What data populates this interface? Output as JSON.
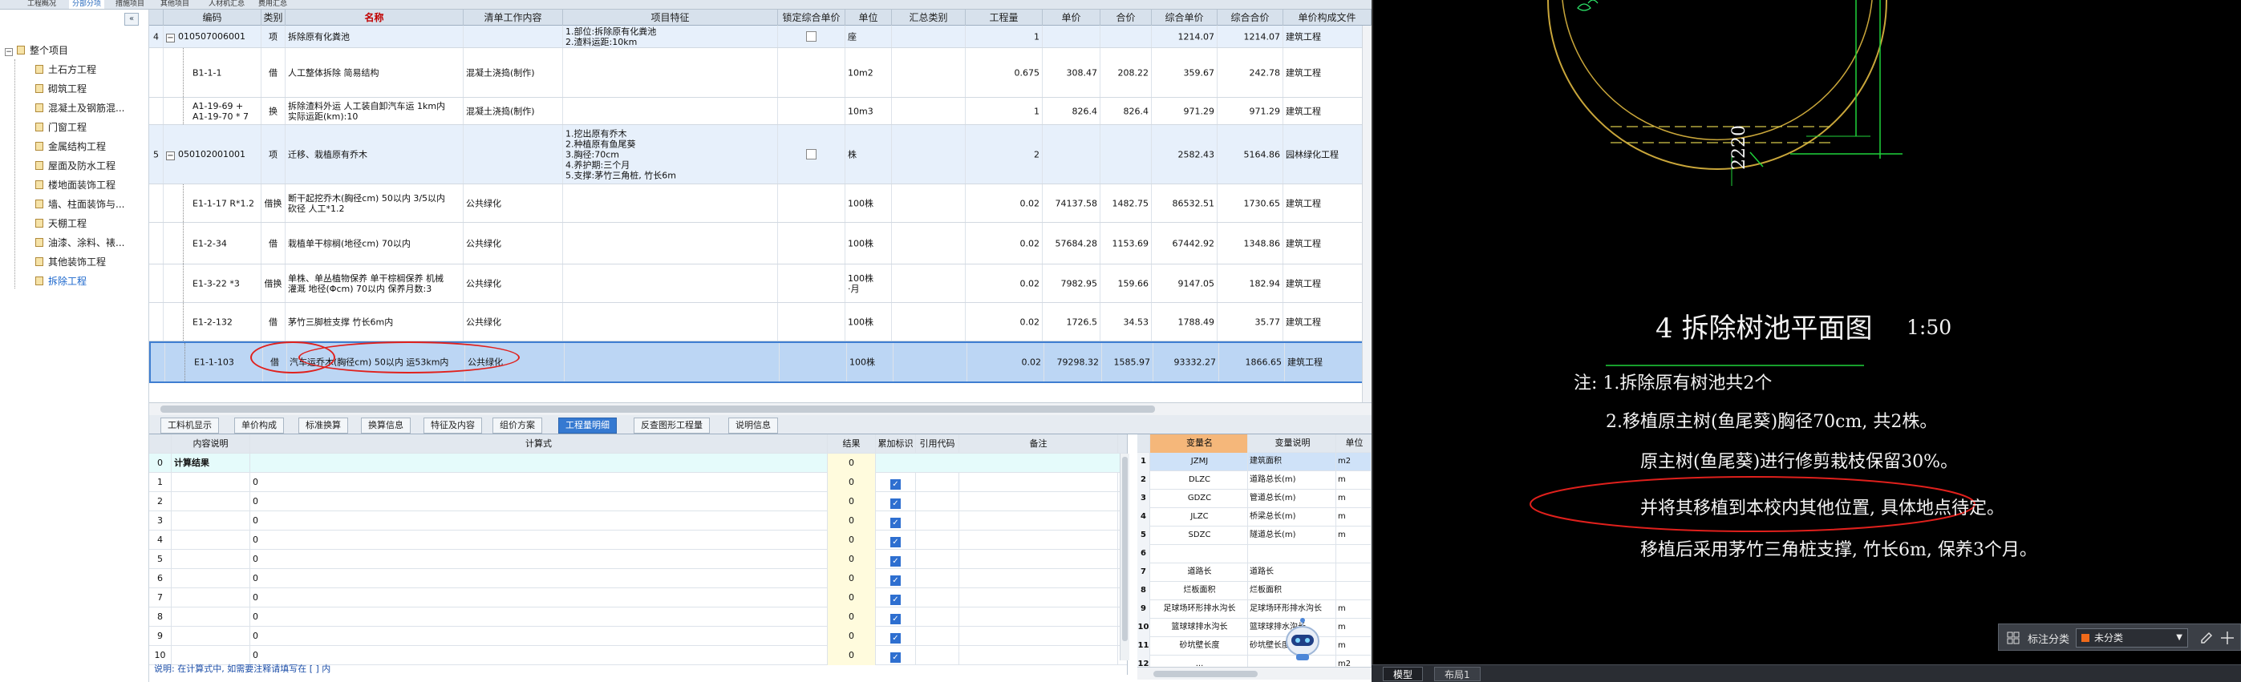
{
  "topbar": {
    "tabs": [
      "工程概况",
      "分部分项",
      "措施项目",
      "其他项目",
      "人材机汇总",
      "费用汇总"
    ],
    "active": 1
  },
  "sidebar": {
    "collapse_label": "«",
    "root": "整个项目",
    "items": [
      "土石方工程",
      "砌筑工程",
      "混凝土及钢筋混...",
      "门窗工程",
      "金属结构工程",
      "屋面及防水工程",
      "楼地面装饰工程",
      "墙、柱面装饰与...",
      "天棚工程",
      "油漆、涂料、裱...",
      "其他装饰工程",
      "拆除工程"
    ],
    "selected_index": 11
  },
  "grid": {
    "headers": [
      "",
      "编码",
      "类别",
      "名称",
      "清单工作内容",
      "项目特征",
      "锁定综合单价",
      "单位",
      "汇总类别",
      "工程量",
      "单价",
      "合价",
      "综合单价",
      "综合合价",
      "单价构成文件"
    ],
    "rows": [
      {
        "num": "4",
        "code": "010507006001",
        "type": "项",
        "name": "拆除原有化粪池",
        "work": "",
        "feature": "1.部位:拆除原有化粪池\n2.渣料运距:10km",
        "lock": true,
        "unit": "座",
        "sum": "",
        "qty": "1",
        "price": "",
        "total": "",
        "cprice": "1214.07",
        "ctotal": "1214.07",
        "file": "建筑工程"
      },
      {
        "num": "",
        "code": "B1-1-1",
        "type": "借",
        "name": "人工整体拆除 简易结构",
        "work": "混凝土浇捣(制作)",
        "feature": "",
        "lock": false,
        "unit": "10m2",
        "sum": "",
        "qty": "0.675",
        "price": "308.47",
        "total": "208.22",
        "cprice": "359.67",
        "ctotal": "242.78",
        "file": "建筑工程"
      },
      {
        "num": "",
        "code": "A1-19-69 +\nA1-19-70 * 7",
        "type": "换",
        "name": "拆除渣料外运 人工装自卸汽车运 1km内\n实际运距(km):10",
        "work": "混凝土浇捣(制作)",
        "feature": "",
        "lock": false,
        "unit": "10m3",
        "sum": "",
        "qty": "1",
        "price": "826.4",
        "total": "826.4",
        "cprice": "971.29",
        "ctotal": "971.29",
        "file": "建筑工程"
      },
      {
        "num": "5",
        "code": "050102001001",
        "type": "项",
        "name": "迁移、栽植原有乔木",
        "work": "",
        "feature": "1.挖出原有乔木\n2.种植原有鱼尾葵\n3.胸径:70cm\n4.养护期:三个月\n5.支撑:茅竹三角桩, 竹长6m",
        "lock": true,
        "unit": "株",
        "sum": "",
        "qty": "2",
        "price": "",
        "total": "",
        "cprice": "2582.43",
        "ctotal": "5164.86",
        "file": "园林绿化工程"
      },
      {
        "num": "",
        "code": "E1-1-17 R*1.2",
        "type": "借换",
        "name": "断干起挖乔木(胸径cm) 50以内  3/5以内\n砍径 人工*1.2",
        "work": "公共绿化",
        "feature": "",
        "lock": false,
        "unit": "100株",
        "sum": "",
        "qty": "0.02",
        "price": "74137.58",
        "total": "1482.75",
        "cprice": "86532.51",
        "ctotal": "1730.65",
        "file": "建筑工程"
      },
      {
        "num": "",
        "code": "E1-2-34",
        "type": "借",
        "name": "栽植单干棕榈(地径cm) 70以内",
        "work": "公共绿化",
        "feature": "",
        "lock": false,
        "unit": "100株",
        "sum": "",
        "qty": "0.02",
        "price": "57684.28",
        "total": "1153.69",
        "cprice": "67442.92",
        "ctotal": "1348.86",
        "file": "建筑工程"
      },
      {
        "num": "",
        "code": "E1-3-22 *3",
        "type": "借换",
        "name": "单株、单丛植物保养 单干棕榈保养 机械\n灌溉 地径(Φcm) 70以内  保养月数:3",
        "work": "公共绿化",
        "feature": "",
        "lock": false,
        "unit": "100株\n·月",
        "sum": "",
        "qty": "0.02",
        "price": "7982.95",
        "total": "159.66",
        "cprice": "9147.05",
        "ctotal": "182.94",
        "file": "建筑工程"
      },
      {
        "num": "",
        "code": "E1-2-132",
        "type": "借",
        "name": "茅竹三脚桩支撑 竹长6m内",
        "work": "公共绿化",
        "feature": "",
        "lock": false,
        "unit": "100株",
        "sum": "",
        "qty": "0.02",
        "price": "1726.5",
        "total": "34.53",
        "cprice": "1788.49",
        "ctotal": "35.77",
        "file": "建筑工程"
      },
      {
        "num": "",
        "code": "E1-1-103",
        "type": "借",
        "name": "汽车运乔木(胸径cm) 50以内 运53km内",
        "work": "公共绿化",
        "feature": "",
        "lock": false,
        "unit": "100株",
        "sum": "",
        "qty": "0.02",
        "price": "79298.32",
        "total": "1585.97",
        "cprice": "93332.27",
        "ctotal": "1866.65",
        "file": "建筑工程"
      }
    ]
  },
  "bottom_tabs": [
    "工料机显示",
    "单价构成",
    "标准换算",
    "换算信息",
    "特征及内容",
    "组价方案",
    "工程量明细",
    "反查图形工程量",
    "说明信息"
  ],
  "bottom_tab_active": 6,
  "formula": {
    "headers": [
      "",
      "内容说明",
      "计算式",
      "结果",
      "累加标识",
      "引用代码",
      "备注"
    ],
    "result_row": {
      "num": "0",
      "label": "计算结果",
      "result": "0"
    },
    "rows": [
      {
        "num": "1",
        "expr": "0",
        "result": "0"
      },
      {
        "num": "2",
        "expr": "0",
        "result": "0"
      },
      {
        "num": "3",
        "expr": "0",
        "result": "0"
      },
      {
        "num": "4",
        "expr": "0",
        "result": "0"
      },
      {
        "num": "5",
        "expr": "0",
        "result": "0"
      },
      {
        "num": "6",
        "expr": "0",
        "result": "0"
      },
      {
        "num": "7",
        "expr": "0",
        "result": "0"
      },
      {
        "num": "8",
        "expr": "0",
        "result": "0"
      },
      {
        "num": "9",
        "expr": "0",
        "result": "0"
      },
      {
        "num": "10",
        "expr": "0",
        "result": "0"
      }
    ],
    "check_glyph": "✓",
    "note": "说明: 在计算式中, 如需要注释请填写在 [ ] 内"
  },
  "variables": {
    "headers": [
      "",
      "变量名",
      "变量说明",
      "单位"
    ],
    "rows": [
      {
        "num": "1",
        "name": "JZMJ",
        "desc": "建筑面积",
        "unit": "m2"
      },
      {
        "num": "2",
        "name": "DLZC",
        "desc": "道路总长(m)",
        "unit": "m"
      },
      {
        "num": "3",
        "name": "GDZC",
        "desc": "管道总长(m)",
        "unit": "m"
      },
      {
        "num": "4",
        "name": "JLZC",
        "desc": "桥梁总长(m)",
        "unit": "m"
      },
      {
        "num": "5",
        "name": "SDZC",
        "desc": "隧道总长(m)",
        "unit": "m"
      },
      {
        "num": "6",
        "name": "",
        "desc": "",
        "unit": ""
      },
      {
        "num": "7",
        "name": "道路长",
        "desc": "道路长",
        "unit": ""
      },
      {
        "num": "8",
        "name": "烂板面积",
        "desc": "烂板面积",
        "unit": ""
      },
      {
        "num": "9",
        "name": "足球场环形排水沟长",
        "desc": "足球场环形排水沟长",
        "unit": "m"
      },
      {
        "num": "10",
        "name": "篮球球排水沟长",
        "desc": "篮球球排水沟长",
        "unit": "m"
      },
      {
        "num": "11",
        "name": "砂坑壁长度",
        "desc": "砂坑壁长度",
        "unit": "m"
      },
      {
        "num": "12",
        "name": "...",
        "desc": "",
        "unit": "m2"
      }
    ]
  },
  "cad": {
    "dimension": "2220",
    "title": "4 拆除树池平面图",
    "scale": "1:50",
    "notes": [
      "注: 1.拆除原有树池共2个",
      "2.移植原主树(鱼尾葵)胸径70cm, 共2株。",
      "原主树(鱼尾葵)进行修剪栽枝保留30%。",
      "并将其移植到本校内其他位置, 具体地点待定。",
      "移植后采用茅竹三角桩支撑, 竹长6m, 保养3个月。"
    ],
    "tabs": [
      "模型",
      "布局1"
    ],
    "annotation_label": "标注分类",
    "annotation_value": "未分类"
  }
}
